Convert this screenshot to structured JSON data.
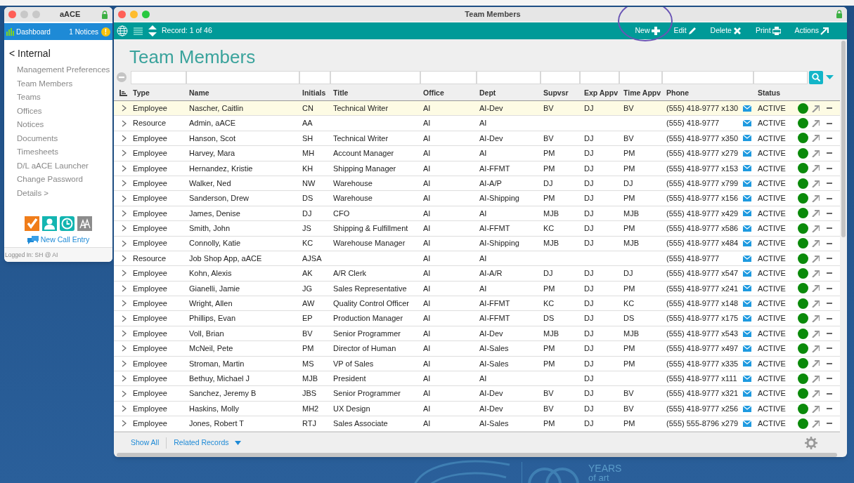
{
  "side_window": {
    "title": "aACE",
    "dashboard": "Dashboard",
    "notices": "1 Notices",
    "notice_badge": "!",
    "back_link": "< Internal",
    "menu": [
      "Management Preferences",
      "Team Members",
      "Teams",
      "Offices",
      "Notices",
      "Documents",
      "Timesheets",
      "D/L aACE Launcher",
      "Change Password",
      "Details >"
    ],
    "new_call": "New Call Entry",
    "status": "Logged In: SH @ AI"
  },
  "window": {
    "title": "Team Members"
  },
  "toolbar": {
    "record": "Record: 1 of 46",
    "actions": [
      {
        "label": "New",
        "kind": "plus",
        "circled": true
      },
      {
        "label": "Edit",
        "kind": "pencil",
        "circled": false
      },
      {
        "label": "Delete",
        "kind": "cross",
        "circled": false
      },
      {
        "label": "Print",
        "kind": "printer",
        "circled": false
      },
      {
        "label": "Actions",
        "kind": "arrow",
        "circled": false
      }
    ]
  },
  "heading": "Team Members",
  "table": {
    "columns": [
      "Type",
      "Name",
      "Initials",
      "Title",
      "Office",
      "Dept",
      "Supvsr",
      "Exp Appv",
      "Time Appv",
      "Phone",
      "Status"
    ],
    "rows": [
      {
        "selected": true,
        "cells": [
          "Employee",
          "Nascher, Caitlin",
          "CN",
          "Technical Writer",
          "AI",
          "AI-Dev",
          "BV",
          "DJ",
          "BV",
          "(555) 418-9777 x130",
          "ACTIVE"
        ]
      },
      {
        "selected": false,
        "cells": [
          "Resource",
          "Admin, aACE",
          "AA",
          "",
          "AI",
          "AI",
          "",
          "",
          "",
          "(555) 418-9777",
          "ACTIVE"
        ]
      },
      {
        "selected": false,
        "cells": [
          "Employee",
          "Hanson, Scot",
          "SH",
          "Technical Writer",
          "AI",
          "AI-Dev",
          "BV",
          "DJ",
          "BV",
          "(555) 418-9777 x350",
          "ACTIVE"
        ]
      },
      {
        "selected": false,
        "cells": [
          "Employee",
          "Harvey, Mara",
          "MH",
          "Account Manager",
          "AI",
          "AI",
          "PM",
          "DJ",
          "PM",
          "(555) 418-9777 x279",
          "ACTIVE"
        ]
      },
      {
        "selected": false,
        "cells": [
          "Employee",
          "Hernandez, Kristie",
          "KH",
          "Shipping Manager",
          "AI",
          "AI-FFMT",
          "PM",
          "DJ",
          "PM",
          "(555) 418-9777 x153",
          "ACTIVE"
        ]
      },
      {
        "selected": false,
        "cells": [
          "Employee",
          "Walker, Ned",
          "NW",
          "Warehouse",
          "AI",
          "AI-A/P",
          "DJ",
          "DJ",
          "DJ",
          "(555) 418-9777 x799",
          "ACTIVE"
        ]
      },
      {
        "selected": false,
        "cells": [
          "Employee",
          "Sanderson, Drew",
          "DS",
          "Warehouse",
          "AI",
          "AI-Shipping",
          "PM",
          "DJ",
          "PM",
          "(555) 418-9777 x156",
          "ACTIVE"
        ]
      },
      {
        "selected": false,
        "cells": [
          "Employee",
          "James, Denise",
          "DJ",
          "CFO",
          "AI",
          "AI",
          "MJB",
          "DJ",
          "MJB",
          "(555) 418-9777 x429",
          "ACTIVE"
        ]
      },
      {
        "selected": false,
        "cells": [
          "Employee",
          "Smith, John",
          "JS",
          "Shipping & Fulfillment",
          "AI",
          "AI-FFMT",
          "KC",
          "DJ",
          "PM",
          "(555) 418-9777 x586",
          "ACTIVE"
        ]
      },
      {
        "selected": false,
        "cells": [
          "Employee",
          "Connolly, Katie",
          "KC",
          "Warehouse Manager",
          "AI",
          "AI-Shipping",
          "MJB",
          "DJ",
          "MJB",
          "(555) 418-9777 x484",
          "ACTIVE"
        ]
      },
      {
        "selected": false,
        "cells": [
          "Resource",
          "Job Shop App, aACE",
          "AJSA",
          "",
          "AI",
          "AI",
          "",
          "",
          "",
          "(555) 418-9777",
          "ACTIVE"
        ]
      },
      {
        "selected": false,
        "cells": [
          "Employee",
          "Kohn, Alexis",
          "AK",
          "A/R Clerk",
          "AI",
          "AI-A/R",
          "DJ",
          "DJ",
          "DJ",
          "(555) 418-9777 x547",
          "ACTIVE"
        ]
      },
      {
        "selected": false,
        "cells": [
          "Employee",
          "Gianelli, Jamie",
          "JG",
          "Sales Representative",
          "AI",
          "AI",
          "PM",
          "DJ",
          "PM",
          "(555) 418-9777 x241",
          "ACTIVE"
        ]
      },
      {
        "selected": false,
        "cells": [
          "Employee",
          "Wright, Allen",
          "AW",
          "Quality Control Officer",
          "AI",
          "AI-FFMT",
          "KC",
          "DJ",
          "KC",
          "(555) 418-9777 x148",
          "ACTIVE"
        ]
      },
      {
        "selected": false,
        "cells": [
          "Employee",
          "Phillips, Evan",
          "EP",
          "Production Manager",
          "AI",
          "AI-FFMT",
          "DS",
          "DJ",
          "DS",
          "(555) 418-9777 x175",
          "ACTIVE"
        ]
      },
      {
        "selected": false,
        "cells": [
          "Employee",
          "Voll, Brian",
          "BV",
          "Senior Programmer",
          "AI",
          "AI-Dev",
          "MJB",
          "DJ",
          "MJB",
          "(555) 418-9777 x543",
          "ACTIVE"
        ]
      },
      {
        "selected": false,
        "cells": [
          "Employee",
          "McNeil, Pete",
          "PM",
          "Director of Human",
          "AI",
          "AI-Sales",
          "PM",
          "DJ",
          "PM",
          "(555) 418-9777 x497",
          "ACTIVE"
        ]
      },
      {
        "selected": false,
        "cells": [
          "Employee",
          "Stroman, Martin",
          "MS",
          "VP of Sales",
          "AI",
          "AI-Sales",
          "PM",
          "DJ",
          "PM",
          "(555) 418-9777 x335",
          "ACTIVE"
        ]
      },
      {
        "selected": false,
        "cells": [
          "Employee",
          "Bethuy, Michael J",
          "MJB",
          "President",
          "AI",
          "AI",
          "",
          "DJ",
          "",
          "(555) 418-9777 x111",
          "ACTIVE"
        ]
      },
      {
        "selected": false,
        "cells": [
          "Employee",
          "Sanchez, Jeremy B",
          "JBS",
          "Senior Programmer",
          "AI",
          "AI-Dev",
          "BV",
          "DJ",
          "BV",
          "(555) 418-9777 x321",
          "ACTIVE"
        ]
      },
      {
        "selected": false,
        "cells": [
          "Employee",
          "Haskins, Molly",
          "MH2",
          "UX Design",
          "AI",
          "AI-Dev",
          "BV",
          "DJ",
          "BV",
          "(555) 418-9777 x256",
          "ACTIVE"
        ]
      },
      {
        "selected": false,
        "cells": [
          "Employee",
          "Jones, Robert T",
          "RTJ",
          "Sales Associate",
          "AI",
          "AI-Sales",
          "PM",
          "DJ",
          "PM",
          "(555) 555-8796 x279",
          "ACTIVE"
        ]
      }
    ]
  },
  "footer": {
    "show_all": "Show All",
    "related": "Related Records"
  },
  "wallpaper": {
    "tagline_1": "YEARS",
    "tagline_2": "of art"
  }
}
